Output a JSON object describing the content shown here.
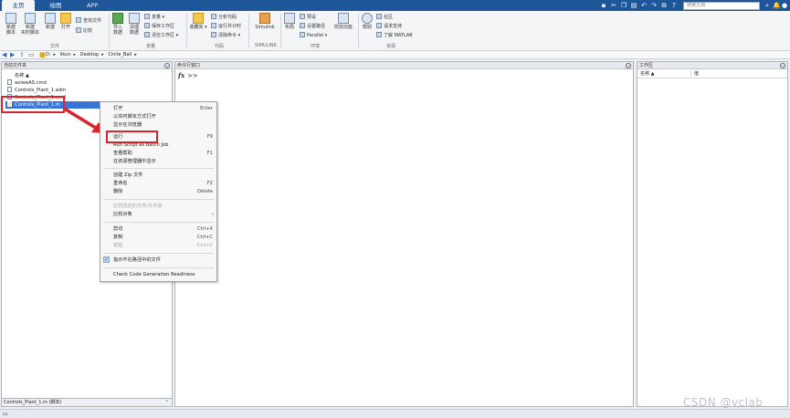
{
  "tabs": [
    {
      "label": "主页",
      "active": true
    },
    {
      "label": "绘图",
      "active": false
    },
    {
      "label": "APP",
      "active": false
    }
  ],
  "search": {
    "placeholder": "搜索文档"
  },
  "ribbon": {
    "file": {
      "new_script": "新建\n脚本",
      "new_live_script": "新建\n实时脚本",
      "new": "新建",
      "open": "打开",
      "find_files": "查找文件",
      "compare": "比较",
      "group": "文件"
    },
    "variable": {
      "import": "导入\n数据",
      "clean": "清理\n数据",
      "new_variable": "变量",
      "save_workspace": "保存工作区",
      "clear_workspace": "清空工作区",
      "group": "变量"
    },
    "code": {
      "favorites": "收藏夹",
      "analyze": "分析代码",
      "run_time": "运行并计时",
      "clear_cmd": "清除命令",
      "group": "代码"
    },
    "simulink": {
      "label": "Simulink",
      "group": "SIMULINK"
    },
    "env": {
      "layout": "布局",
      "preferences": "预设",
      "set_path": "设置路径",
      "parallel": "Parallel",
      "addons": "附加功能",
      "group": "环境"
    },
    "resources": {
      "help": "帮助",
      "community": "社区",
      "support": "请求支持",
      "learn": "了解 MATLAB",
      "group": "资源"
    }
  },
  "address": {
    "path": [
      "D:",
      "likun",
      "Desktop",
      "Circle_Ball"
    ]
  },
  "file_browser": {
    "title": "当前文件夹",
    "files": [
      {
        "name": "名称 ▲",
        "selected": false
      },
      {
        "name": "aviewAS.cmd",
        "selected": false
      },
      {
        "name": "Controls_Plant_1.adm",
        "selected": false
      },
      {
        "name": "Controls_Plant_1.cmd",
        "selected": false
      },
      {
        "name": "Controls_Plant_1.m",
        "selected": true
      }
    ],
    "details": "Controls_Plant_1.m (脚本)"
  },
  "command_window": {
    "title": "命令行窗口",
    "fx": "fx",
    "prompt": ">>"
  },
  "workspace": {
    "title": "工作区",
    "col_name": "名称 ▲",
    "col_value": "值"
  },
  "context_menu": {
    "items": [
      {
        "label": "打开",
        "shortcut": "Enter",
        "disabled": false
      },
      {
        "label": "以实时脚本方式打开",
        "shortcut": "",
        "disabled": false
      },
      {
        "label": "显示在浏览器",
        "shortcut": "",
        "disabled": false
      },
      {
        "label": "运行",
        "shortcut": "F9",
        "disabled": false
      },
      {
        "label": "Run Script as Batch Job",
        "shortcut": "",
        "disabled": false
      },
      {
        "label": "查看帮助",
        "shortcut": "F1",
        "disabled": false
      },
      {
        "label": "在资源管理器中显示",
        "shortcut": "",
        "disabled": false
      },
      {
        "label": "创建 Zip 文件",
        "shortcut": "",
        "disabled": false
      },
      {
        "label": "重命名",
        "shortcut": "F2",
        "disabled": false
      },
      {
        "label": "删除",
        "shortcut": "Delete",
        "disabled": false
      },
      {
        "label": "比较选定的文件/文件夹",
        "shortcut": "",
        "disabled": true
      },
      {
        "label": "比较对象",
        "shortcut": "",
        "disabled": false
      },
      {
        "label": "剪切",
        "shortcut": "Ctrl+X",
        "disabled": false
      },
      {
        "label": "复制",
        "shortcut": "Ctrl+C",
        "disabled": false
      },
      {
        "label": "粘贴",
        "shortcut": "Ctrl+V",
        "disabled": true
      },
      {
        "label": "指示不在路径中的文件",
        "shortcut": "",
        "disabled": false
      },
      {
        "label": "Check Code Generation Readiness",
        "shortcut": "",
        "disabled": false
      }
    ]
  },
  "watermark": "CSDN @vclab",
  "colors": {
    "accent": "#1e5799",
    "highlight": "#d9242b",
    "selection": "#3875d7"
  }
}
